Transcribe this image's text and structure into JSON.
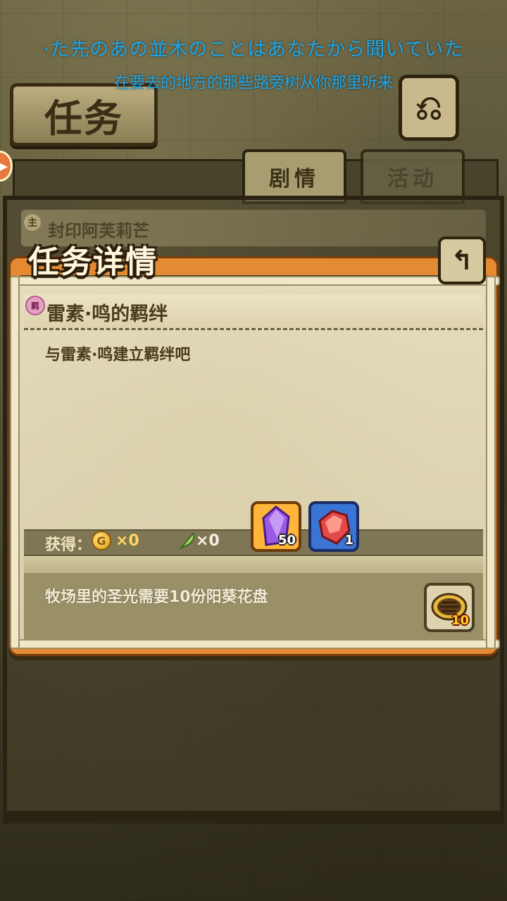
{
  "subtitles": {
    "japanese": "·た先のあの並木のことはあなたから聞いていた",
    "chinese": "在要去的地方的那些路旁树从你那里听来"
  },
  "header": {
    "title": "任务",
    "back_icon": "return-arrow-icon"
  },
  "tabs": [
    {
      "label": "剧情",
      "active": true
    },
    {
      "label": "活动",
      "active": false
    }
  ],
  "quest_list": {
    "items": [
      {
        "badge": "主",
        "name": "封印阿芙莉芒"
      }
    ]
  },
  "detail": {
    "title": "任务详情",
    "quest_badge": "羁",
    "quest_name": "雷素·鸣的羁绊",
    "description": "与雷素·鸣建立羁绊吧",
    "rewards_label": "获得：",
    "gold_count": "×0",
    "feather_count": "×0",
    "reward_items": [
      {
        "icon": "purple-crystal-icon",
        "count": "50"
      },
      {
        "icon": "red-gem-shard-icon",
        "count": "1"
      }
    ],
    "requirement_text": "牧场里的圣光需要10份阳葵花盘",
    "requirement_item": {
      "icon": "sunflower-disc-icon",
      "count": "10"
    }
  },
  "colors": {
    "subtitle": "#1fa6e6",
    "dialog_border": "#e38a32",
    "parchment": "#e5dcbc"
  }
}
